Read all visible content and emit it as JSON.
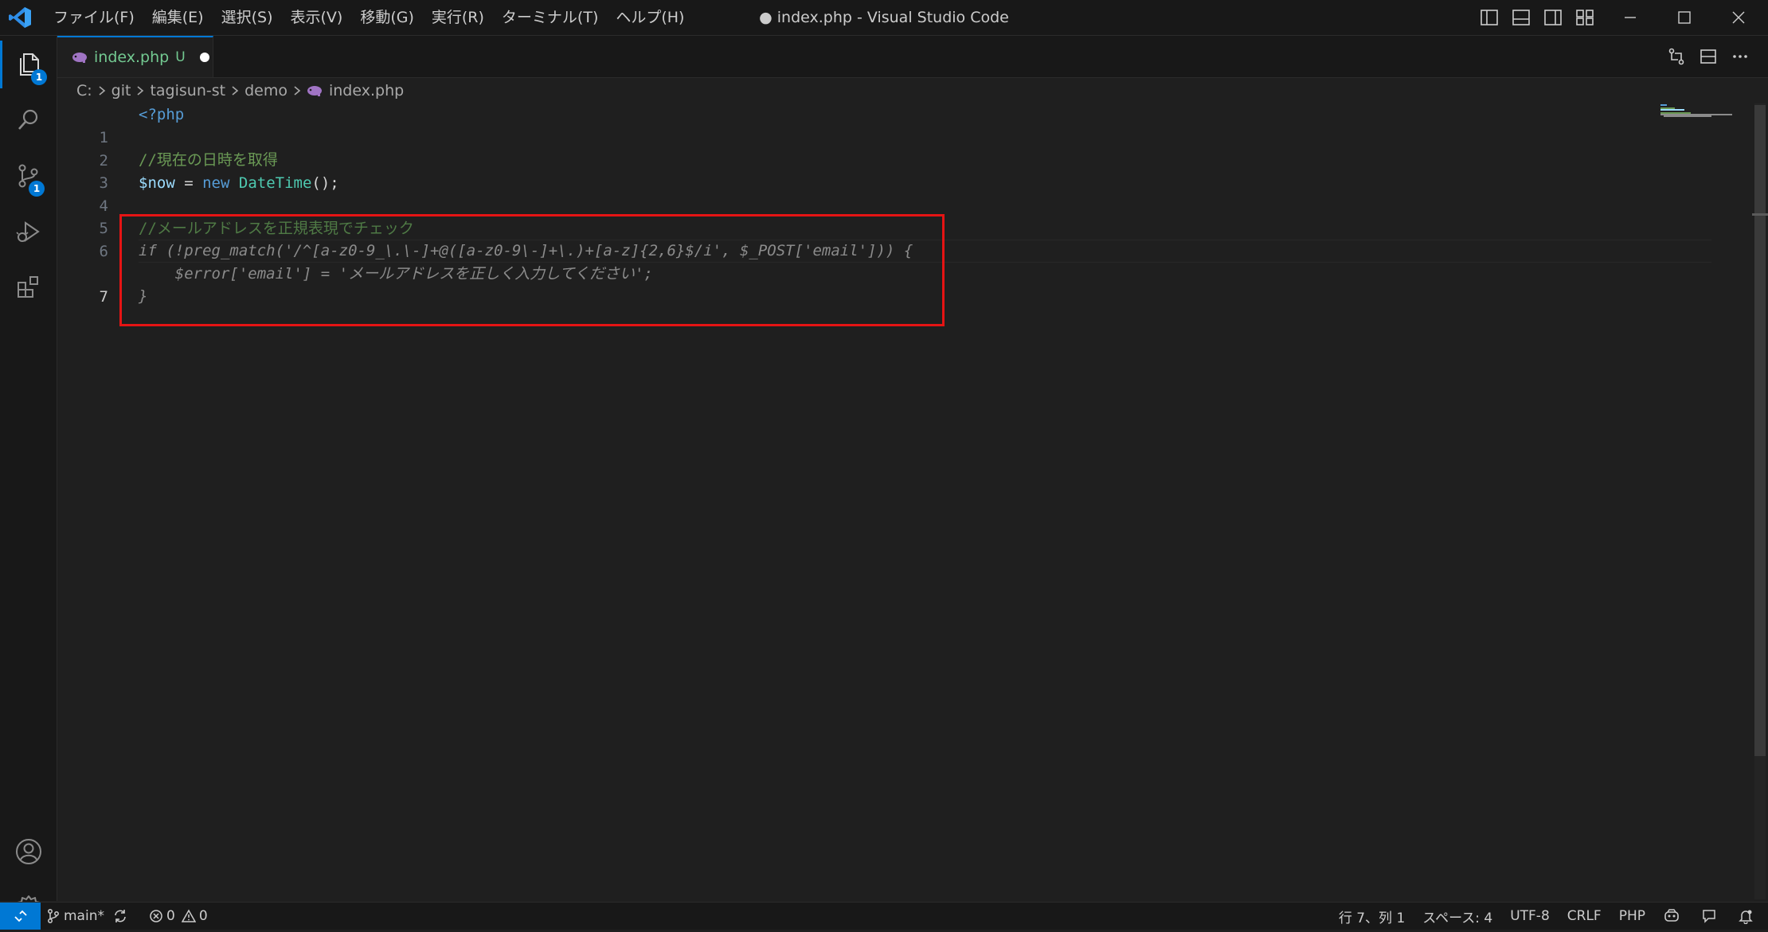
{
  "window": {
    "title": "● index.php - Visual Studio Code",
    "app_icon": "vscode-logo-icon"
  },
  "menu": {
    "items": [
      "ファイル(F)",
      "編集(E)",
      "選択(S)",
      "表示(V)",
      "移動(G)",
      "実行(R)",
      "ターミナル(T)",
      "ヘルプ(H)"
    ]
  },
  "layout_controls": [
    "toggle-primary-sidebar-icon",
    "toggle-panel-icon",
    "toggle-secondary-sidebar-icon",
    "customize-layout-icon"
  ],
  "window_controls": [
    "minimize-icon",
    "maximize-icon",
    "close-icon"
  ],
  "activity_bar": {
    "items": [
      {
        "name": "explorer",
        "icon": "files-icon",
        "badge": "1"
      },
      {
        "name": "search",
        "icon": "search-icon"
      },
      {
        "name": "source-control",
        "icon": "source-control-icon",
        "badge": "1"
      },
      {
        "name": "run-debug",
        "icon": "run-debug-icon"
      },
      {
        "name": "extensions",
        "icon": "extensions-icon"
      }
    ],
    "bottom": [
      {
        "name": "accounts",
        "icon": "account-icon"
      },
      {
        "name": "manage",
        "icon": "gear-icon"
      }
    ]
  },
  "tabs": [
    {
      "label": "index.php",
      "status": "U",
      "modified": true,
      "icon": "php-elephant-icon"
    }
  ],
  "editor_actions": [
    "open-changes-icon",
    "split-editor-icon",
    "more-actions-icon"
  ],
  "breadcrumb": {
    "items": [
      "C:",
      "git",
      "tagisun-st",
      "demo",
      "index.php"
    ]
  },
  "editor": {
    "lines": [
      {
        "num": "1",
        "text": "<?php"
      },
      {
        "num": "2",
        "text": ""
      },
      {
        "num": "3",
        "text": "//現在の日時を取得"
      },
      {
        "num": "4",
        "text": "$now = new DateTime();"
      },
      {
        "num": "5",
        "text": ""
      },
      {
        "num": "6",
        "text": "//メールアドレスを正規表現でチェック"
      },
      {
        "num": "7",
        "text": "if (!preg_match('/^[a-z0-9_\\.\\-]+@([a-z0-9\\-]+\\.)+[a-z]{2,6}$/i', $_POST['email'])) {"
      },
      {
        "num": "",
        "text": "    $error['email'] = 'メールアドレスを正しく入力してください';"
      },
      {
        "num": "",
        "text": "}"
      }
    ],
    "current_line": "7"
  },
  "status_bar": {
    "remote_icon": "remote-icon",
    "branch": "main*",
    "errors": "0",
    "warnings": "0",
    "cursor": "行 7、列 1",
    "indent": "スペース: 4",
    "encoding": "UTF-8",
    "eol": "CRLF",
    "language": "PHP"
  },
  "colors": {
    "accent": "#0078d4",
    "highlight_box": "#e51414",
    "untracked_file": "#73c991"
  }
}
